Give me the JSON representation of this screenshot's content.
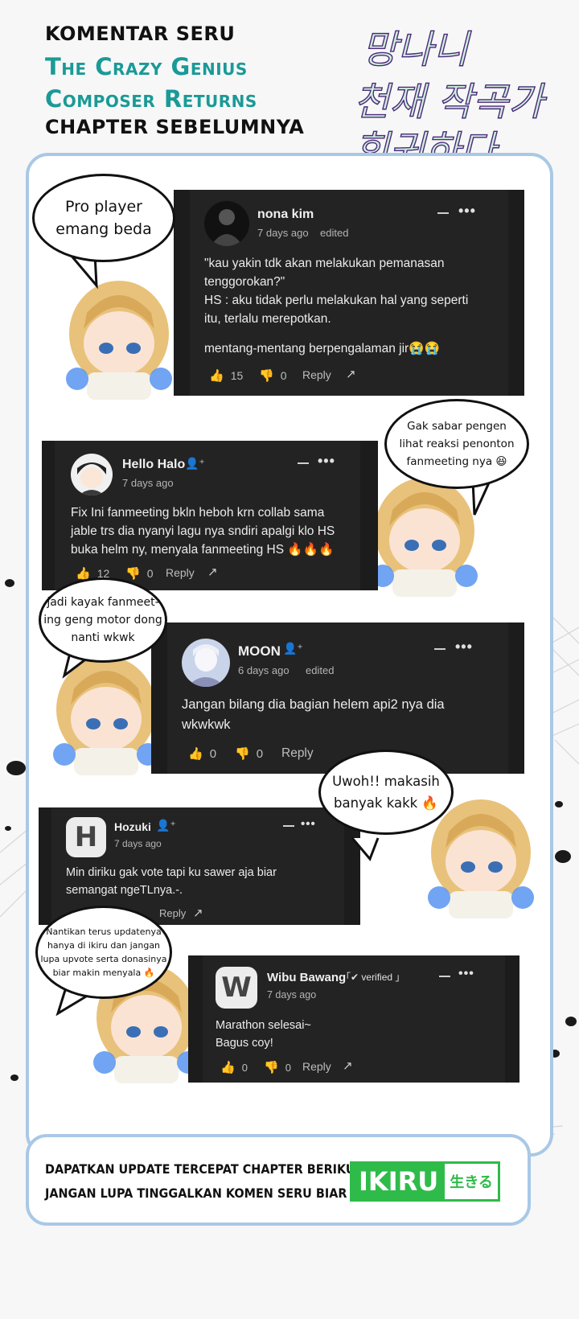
{
  "header": {
    "line1": "KOMENTAR SERU",
    "line2": "The Crazy Genius",
    "line3": "Composer Returns",
    "line4": "CHAPTER SEBELUMNYA",
    "logo_line1": "망나니",
    "logo_line2": "천재 작곡가",
    "logo_line3": "회귀하다"
  },
  "comments": [
    {
      "username": "nona kim",
      "time": "7 days ago",
      "edited": "edited",
      "lines": [
        "\"kau yakin tdk akan melakukan pemanasan",
        "tenggorokan?\"",
        "HS : aku tidak perlu melakukan hal yang seperti",
        "itu, terlalu merepotkan."
      ],
      "line2": "mentang-mentang berpengalaman jir😭😭",
      "likes": "15",
      "dislikes": "0",
      "reply": "Reply"
    },
    {
      "username": "Hello Halo",
      "time": "7 days ago",
      "lines": [
        "Fix Ini fanmeeting bkln heboh krn collab sama",
        "jable trs dia nyanyi lagu nya sndiri apalgi klo HS",
        "buka helm ny, menyala fanmeeting HS 🔥🔥🔥"
      ],
      "likes": "12",
      "dislikes": "0",
      "reply": "Reply"
    },
    {
      "username": "MOON",
      "time": "6 days ago",
      "edited": "edited",
      "lines": [
        "Jangan bilang dia bagian helem api2 nya dia",
        "wkwkwk"
      ],
      "likes": "0",
      "dislikes": "0",
      "reply": "Reply"
    },
    {
      "username": "Hozuki",
      "time": "7 days ago",
      "avatar_letter": "H",
      "lines": [
        "Min diriku gak vote tapi ku sawer aja biar",
        "semangat ngeTLnya.-."
      ],
      "reply": "Reply"
    },
    {
      "username": "Wibu Bawang",
      "badge": "「✔ verified 」",
      "time": "7 days ago",
      "avatar_letter": "W",
      "lines": [
        "Marathon selesai~",
        "Bagus coy!"
      ],
      "likes": "0",
      "dislikes": "0",
      "reply": "Reply"
    }
  ],
  "bubbles": {
    "b1": [
      "Pro player",
      "emang beda"
    ],
    "b2": [
      "Gak sabar pengen",
      "lihat reaksi penonton",
      "fanmeeting nya 😆"
    ],
    "b3": [
      "jadi kayak fanmeet-",
      "ing geng motor dong",
      "nanti wkwk"
    ],
    "b4": [
      "Uwoh!! makasih",
      "banyak kakk 🔥"
    ],
    "b5": [
      "Nantikan terus updatenya",
      "hanya di ikiru dan jangan",
      "lupa upvote serta donasinya",
      "biar makin menyala 🔥"
    ]
  },
  "footer": {
    "line1": "DAPATKAN UPDATE TERCEPAT CHAPTER BERIKUTNYA DI",
    "line2": "JANGAN LUPA TINGGALKAN KOMEN SERU BIAR DI NOTIS",
    "brand": "IKIRU",
    "brand_jp": "生きる"
  },
  "colors": {
    "teal": "#1a9a97",
    "frame": "#a9c8e6",
    "card": "#1c1c1c",
    "brand": "#2fbb4a"
  }
}
